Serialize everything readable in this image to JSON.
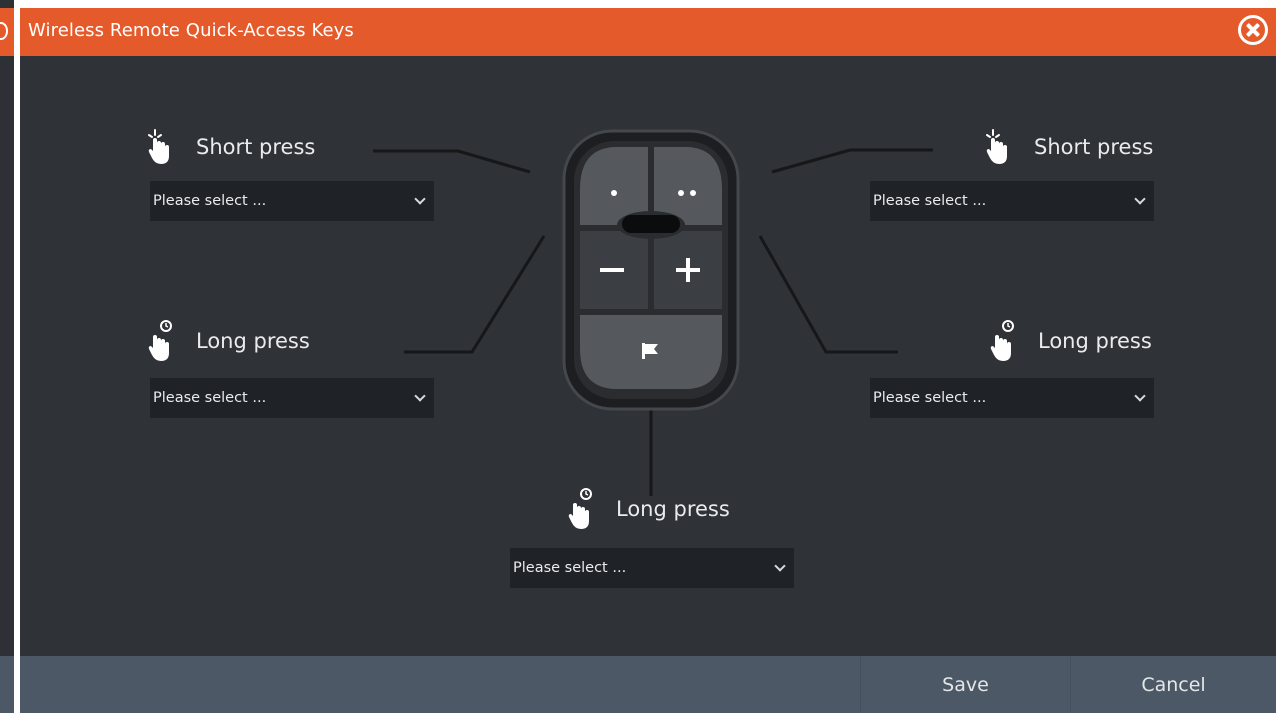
{
  "dialog": {
    "title": "Wireless Remote Quick-Access Keys",
    "close_icon": "close-circle-icon"
  },
  "colors": {
    "titlebar": "#e45a2a",
    "background": "#2f3236",
    "select_bg": "#1f2226",
    "footer": "#4c5866",
    "text": "#e9ebed"
  },
  "keys": {
    "left_short": {
      "label": "Short press",
      "icon": "tap-hand-icon",
      "value": "Please select ..."
    },
    "left_long": {
      "label": "Long press",
      "icon": "long-press-hand-icon",
      "value": "Please select ..."
    },
    "right_short": {
      "label": "Short press",
      "icon": "tap-hand-icon",
      "value": "Please select ..."
    },
    "right_long": {
      "label": "Long press",
      "icon": "long-press-hand-icon",
      "value": "Please select ..."
    },
    "bottom_long": {
      "label": "Long press",
      "icon": "long-press-hand-icon",
      "value": "Please select ..."
    }
  },
  "remote": {
    "buttons": [
      "single-dot-button",
      "double-dot-button",
      "minus-button",
      "plus-button",
      "flag-button"
    ]
  },
  "footer": {
    "save_label": "Save",
    "cancel_label": "Cancel"
  }
}
